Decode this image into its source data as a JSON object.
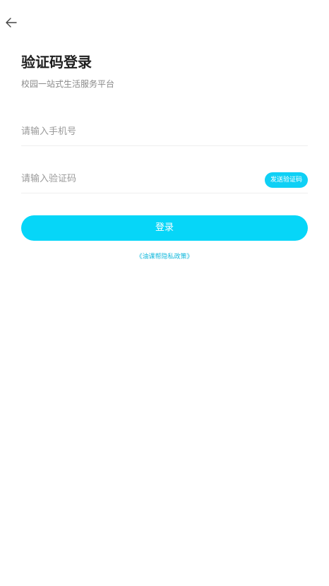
{
  "header": {
    "back_icon": "arrow-left-icon"
  },
  "page": {
    "title": "验证码登录",
    "subtitle": "校园一站式生活服务平台"
  },
  "form": {
    "phone_placeholder": "请输入手机号",
    "phone_value": "",
    "code_placeholder": "请输入验证码",
    "code_value": "",
    "send_code_label": "发送验证码",
    "login_label": "登录"
  },
  "footer": {
    "privacy_link": "《油课帮隐私政策》"
  },
  "colors": {
    "accent": "#06d6f8",
    "link": "#12b8dc",
    "placeholder": "#9a9a9a",
    "divider": "#eeeeee"
  }
}
